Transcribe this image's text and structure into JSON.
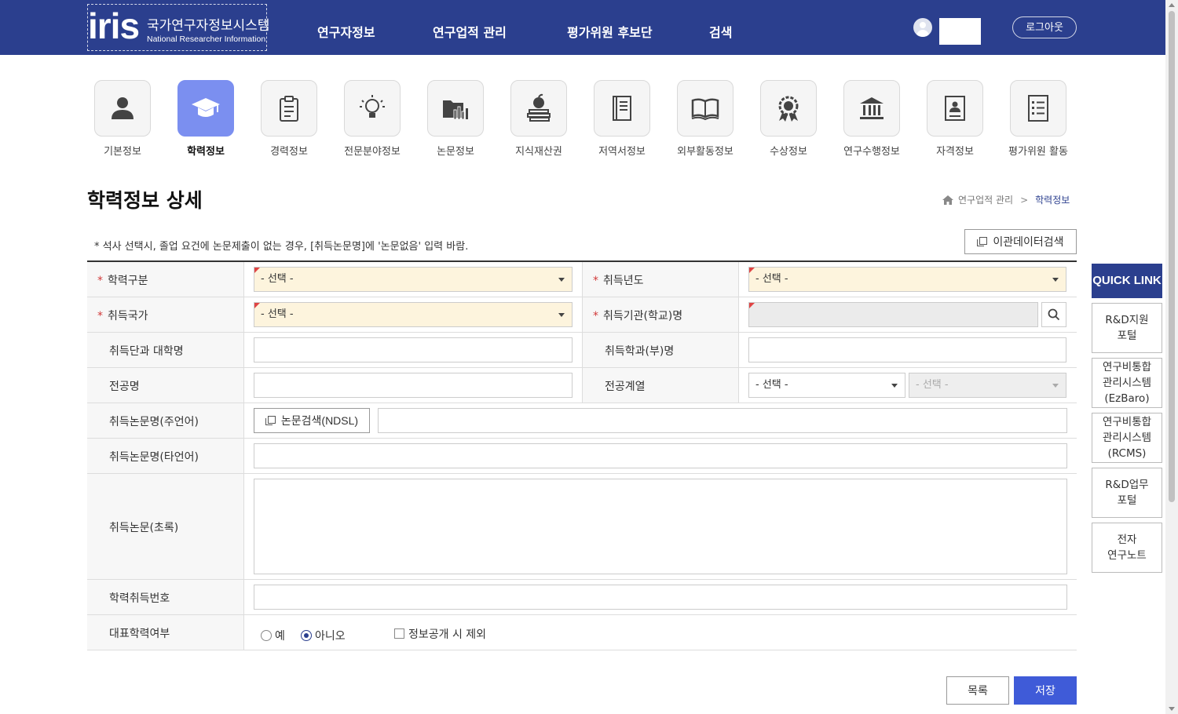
{
  "header": {
    "logo_text": "iris",
    "system_title": "국가연구자정보시스템",
    "system_subtitle": "National Researcher Information",
    "nav": [
      "연구자정보",
      "연구업적 관리",
      "평가위원 후보단",
      "검색"
    ],
    "logout_label": "로그아웃"
  },
  "categories": [
    {
      "label": "기본정보",
      "icon": "person-icon"
    },
    {
      "label": "학력정보",
      "icon": "graduation-cap-icon",
      "active": true
    },
    {
      "label": "경력정보",
      "icon": "clipboard-icon"
    },
    {
      "label": "전문분야정보",
      "icon": "lightbulb-icon"
    },
    {
      "label": "논문정보",
      "icon": "folder-chart-icon"
    },
    {
      "label": "지식재산권",
      "icon": "apple-books-icon"
    },
    {
      "label": "저역서정보",
      "icon": "book-icon"
    },
    {
      "label": "외부활동정보",
      "icon": "open-book-icon"
    },
    {
      "label": "수상정보",
      "icon": "award-icon"
    },
    {
      "label": "연구수행정보",
      "icon": "institution-icon"
    },
    {
      "label": "자격정보",
      "icon": "id-card-icon"
    },
    {
      "label": "평가위원 활동",
      "icon": "checklist-icon"
    }
  ],
  "page": {
    "title": "학력정보 상세",
    "breadcrumb": [
      "연구업적 관리",
      "학력정보"
    ],
    "breadcrumb_sep": ">",
    "notice": "* 석사 선택시, 졸업 요건에 논문제출이 없는 경우, [취득논문명]에 '논문없음' 입력 바람.",
    "transfer_button": "이관데이터검색"
  },
  "form": {
    "required_mark": "*",
    "select_placeholder": "- 선택 -",
    "degree_type_label": "학력구분",
    "year_label": "취득년도",
    "country_label": "취득국가",
    "institution_label": "취득기관(학교)명",
    "college_label": "취득단과 대학명",
    "department_label": "취득학과(부)명",
    "major_label": "전공명",
    "major_field_label": "전공계열",
    "thesis_main_label": "취득논문명(주언어)",
    "ndsl_button": "논문검색(NDSL)",
    "thesis_other_label": "취득논문명(타언어)",
    "abstract_label": "취득논문(초록)",
    "degree_number_label": "학력취득번호",
    "representative_label": "대표학력여부",
    "rep_yes": "예",
    "rep_no": "아니오",
    "rep_selected": "아니오",
    "exclude_public_label": "정보공개 시 제외",
    "exclude_public_checked": false
  },
  "actions": {
    "list_button": "목록",
    "save_button": "저장"
  },
  "quick_link": {
    "title": "QUICK LINK",
    "items": [
      "R&D지원\n포털",
      "연구비통합\n관리시스템\n(EzBaro)",
      "연구비통합\n관리시스템\n(RCMS)",
      "R&D업무\n포털",
      "전자\n연구노트"
    ]
  },
  "colors": {
    "header_bg": "#2b3f8e",
    "active_category": "#7b8ff0",
    "required_field_bg": "#fdf4dd",
    "save_button": "#3f5bd8",
    "required_mark": "#d13a3a"
  }
}
